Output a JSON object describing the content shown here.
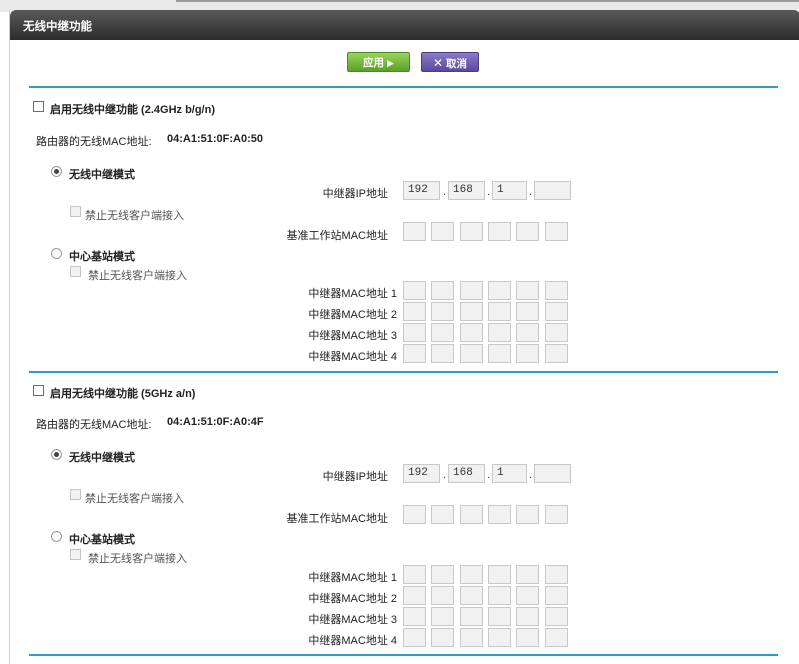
{
  "window": {
    "title": "无线中继功能"
  },
  "toolbar": {
    "apply_label": "应用",
    "cancel_label": "取消"
  },
  "sections": [
    {
      "enable_label": "启用无线中继功能 (2.4GHz b/g/n)",
      "router_mac_label": "路由器的无线MAC地址:",
      "router_mac_value": "04:A1:51:0F:A0:50",
      "repeater_mode_label": "无线中继模式",
      "repeater_ip_label": "中继器IP地址",
      "repeater_ip": [
        "192",
        "168",
        "1",
        ""
      ],
      "disable_clients_label": "禁止无线客户端接入",
      "base_mac_label": "基准工作站MAC地址",
      "base_mode_label": "中心基站模式",
      "disable_clients_label_2": "禁止无线客户端接入",
      "repeater_mac_labels": [
        "中继器MAC地址 1",
        "中继器MAC地址 2",
        "中继器MAC地址 3",
        "中继器MAC地址 4"
      ]
    },
    {
      "enable_label": "启用无线中继功能 (5GHz a/n)",
      "router_mac_label": "路由器的无线MAC地址:",
      "router_mac_value": "04:A1:51:0F:A0:4F",
      "repeater_mode_label": "无线中继模式",
      "repeater_ip_label": "中继器IP地址",
      "repeater_ip": [
        "192",
        "168",
        "1",
        ""
      ],
      "disable_clients_label": "禁止无线客户端接入",
      "base_mac_label": "基准工作站MAC地址",
      "base_mode_label": "中心基站模式",
      "disable_clients_label_2": "禁止无线客户端接入",
      "repeater_mac_labels": [
        "中继器MAC地址 1",
        "中继器MAC地址 2",
        "中继器MAC地址 3",
        "中继器MAC地址 4"
      ]
    }
  ],
  "colors": {
    "accent_line": "#2e9cc4",
    "apply_button": "#6fb23a",
    "cancel_button": "#6a58ae",
    "titlebar": "#3a3a3a"
  }
}
